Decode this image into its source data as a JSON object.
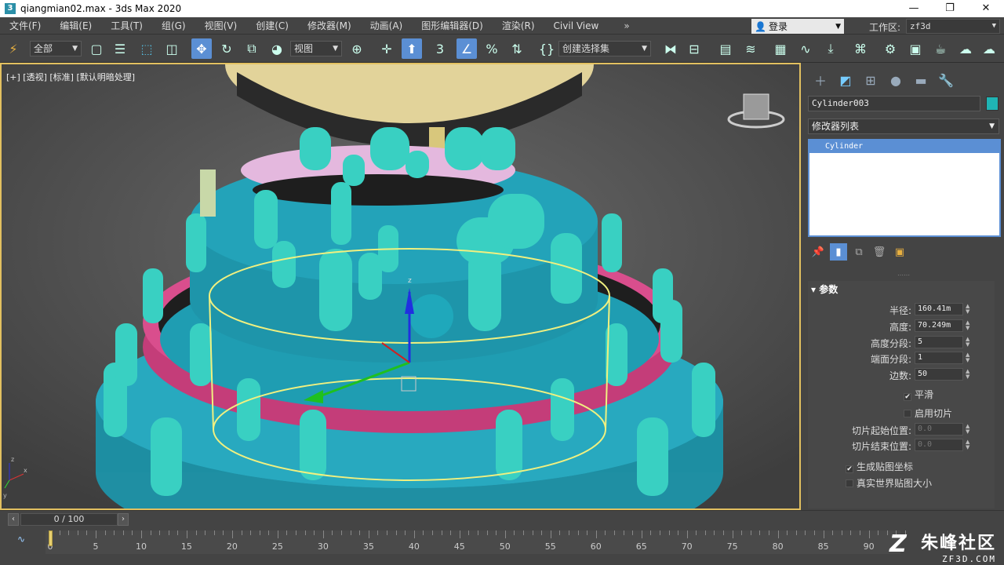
{
  "window": {
    "title": "qiangmian02.max - 3ds Max 2020",
    "app_icon": "3",
    "min": "—",
    "max": "❐",
    "close": "✕"
  },
  "menu": [
    "文件(F)",
    "编辑(E)",
    "工具(T)",
    "组(G)",
    "视图(V)",
    "创建(C)",
    "修改器(M)",
    "动画(A)",
    "图形编辑器(D)",
    "渲染(R)",
    "Civil View"
  ],
  "menu_more": "»",
  "login": {
    "label": "登录"
  },
  "workspace": {
    "label": "工作区:",
    "value": "zf3d"
  },
  "toolbar": {
    "filter": "全部",
    "ref_coord": "视图",
    "selection_set": "创建选择集"
  },
  "viewport": {
    "label": "[+] [透视] [标准] [默认明暗处理]",
    "axis_labels": [
      "z",
      "x",
      "y"
    ]
  },
  "command_panel": {
    "object_name": "Cylinder003",
    "object_color": "#1fb4b4",
    "modifier_list": "修改器列表",
    "stack_items": [
      "Cylinder"
    ],
    "rollout_title": "参数",
    "params": [
      {
        "label": "半径:",
        "value": "160.41m"
      },
      {
        "label": "高度:",
        "value": "70.249m"
      },
      {
        "label": "高度分段:",
        "value": "5"
      },
      {
        "label": "端面分段:",
        "value": "1"
      },
      {
        "label": "边数:",
        "value": "50"
      }
    ],
    "smooth": {
      "label": "平滑",
      "checked": true
    },
    "slice_on": {
      "label": "启用切片",
      "checked": false
    },
    "slice_from": {
      "label": "切片起始位置:",
      "value": "0.0"
    },
    "slice_to": {
      "label": "切片结束位置:",
      "value": "0.0"
    },
    "gen_map": {
      "label": "生成贴图坐标",
      "checked": true
    },
    "real_world": {
      "label": "真实世界贴图大小",
      "checked": false
    }
  },
  "timeline": {
    "frame_display": "0 / 100",
    "tick_labels": [
      "0",
      "5",
      "10",
      "15",
      "20",
      "25",
      "30",
      "35",
      "40",
      "45",
      "50",
      "55",
      "60",
      "65",
      "70",
      "75",
      "80",
      "85",
      "90"
    ]
  },
  "watermark": {
    "cn": "朱峰社区",
    "url": "ZF3D.COM",
    "logo": "Z"
  }
}
